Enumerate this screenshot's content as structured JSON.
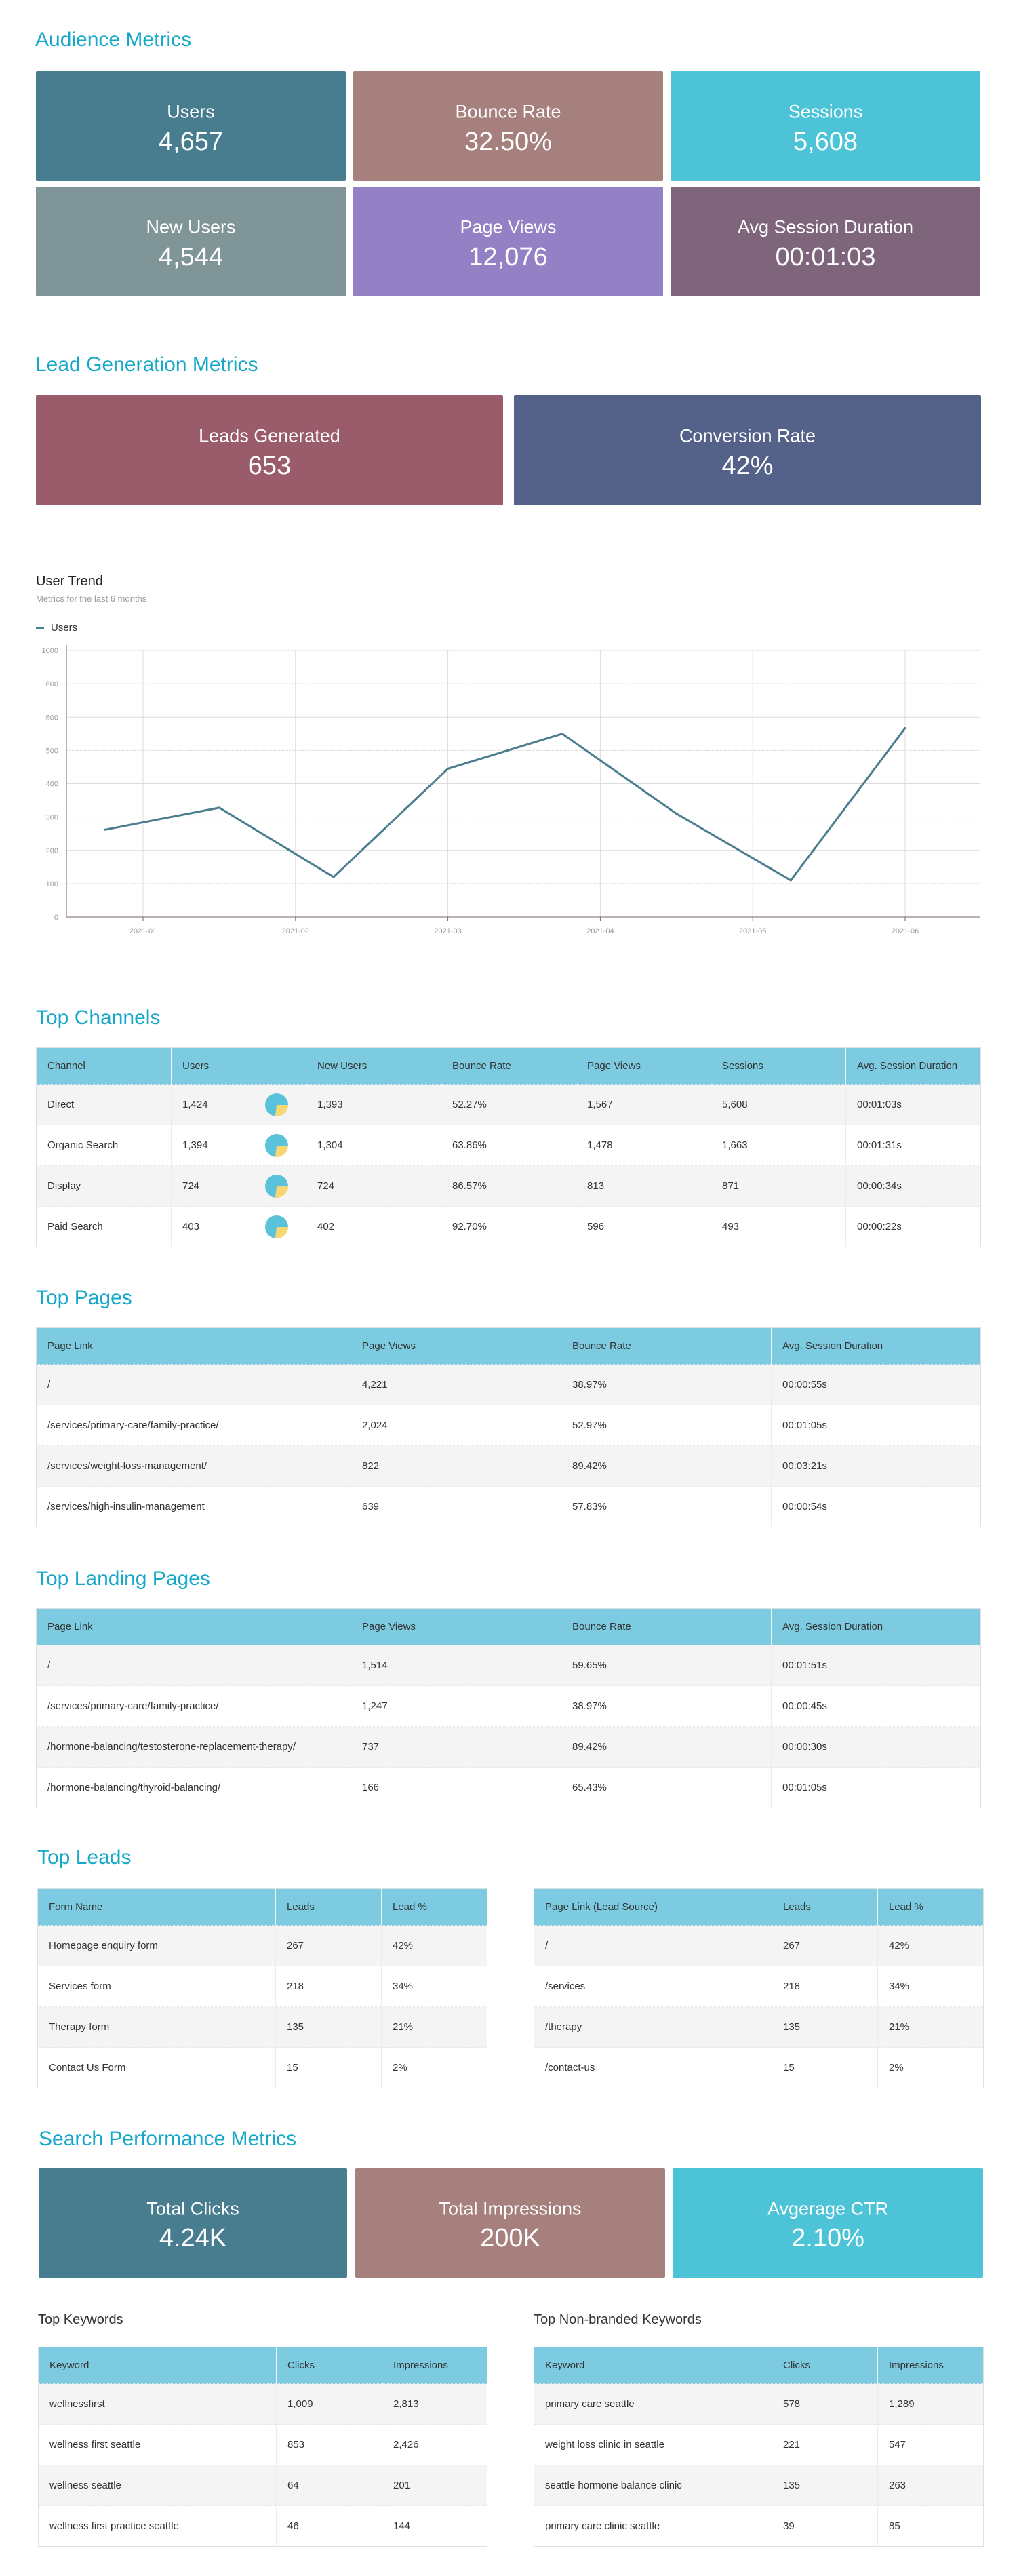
{
  "audience": {
    "title": "Audience Metrics",
    "cards": [
      {
        "label": "Users",
        "value": "4,657",
        "color": "#487d8f"
      },
      {
        "label": "Bounce Rate",
        "value": "32.50%",
        "color": "#a6807d"
      },
      {
        "label": "Sessions",
        "value": "5,608",
        "color": "#4cc3d6"
      },
      {
        "label": "New Users",
        "value": "4,544",
        "color": "#809598"
      },
      {
        "label": "Page Views",
        "value": "12,076",
        "color": "#9480c5"
      },
      {
        "label": "Avg Session Duration",
        "value": "00:01:03",
        "color": "#7e657c"
      }
    ]
  },
  "lead_generation": {
    "title": "Lead Generation Metrics",
    "cards": [
      {
        "label": "Leads Generated",
        "value": "653",
        "color": "#9a5c6a"
      },
      {
        "label": "Conversion Rate",
        "value": "42%",
        "color": "#546289"
      }
    ]
  },
  "chart_data": {
    "type": "line",
    "title": "User Trend",
    "subtitle": "Metrics for the last 6 months",
    "legend": [
      {
        "name": "Users",
        "color": "#4a7d8e"
      }
    ],
    "legend_position": "top-left",
    "xlabel": "",
    "ylabel": "",
    "x_ticks": [
      "2021-01",
      "2021-02",
      "2021-03",
      "2021-04",
      "2021-05",
      "2021-06"
    ],
    "y_ticks": [
      "0",
      "100",
      "200",
      "300",
      "400",
      "500",
      "600",
      "800",
      "1000"
    ],
    "grid": true,
    "series": [
      {
        "name": "Users",
        "x": [
          -0.25,
          0.5,
          1.25,
          2.0,
          2.75,
          3.5,
          4.25,
          5.0
        ],
        "x_labels_note": "points fall roughly halfway between monthly ticks",
        "values": [
          262,
          328,
          120,
          445,
          550,
          310,
          110,
          567
        ]
      }
    ]
  },
  "top_channels": {
    "title": "Top Channels",
    "columns": [
      "Channel",
      "Users",
      "New Users",
      "Bounce Rate",
      "Page Views",
      "Sessions",
      "Avg. Session Duration"
    ],
    "rows": [
      {
        "channel": "Direct",
        "users": "1,424",
        "new_users": "1,393",
        "bounce_rate": "52.27%",
        "page_views": "1,567",
        "sessions": "5,608",
        "avg_duration": "00:01:03s",
        "pie_share": 0.73
      },
      {
        "channel": "Organic Search",
        "users": "1,394",
        "new_users": "1,304",
        "bounce_rate": "63.86%",
        "page_views": "1,478",
        "sessions": "1,663",
        "avg_duration": "00:01:31s",
        "pie_share": 0.73
      },
      {
        "channel": "Display",
        "users": "724",
        "new_users": "724",
        "bounce_rate": "86.57%",
        "page_views": "813",
        "sessions": "871",
        "avg_duration": "00:00:34s",
        "pie_share": 0.73
      },
      {
        "channel": "Paid Search",
        "users": "403",
        "new_users": "402",
        "bounce_rate": "92.70%",
        "page_views": "596",
        "sessions": "493",
        "avg_duration": "00:00:22s",
        "pie_share": 0.73
      }
    ],
    "pie_colors": {
      "main": "#5bc2dc",
      "rest": "#f7d774"
    }
  },
  "top_pages": {
    "title": "Top Pages",
    "columns": [
      "Page Link",
      "Page Views",
      "Bounce Rate",
      "Avg. Session Duration"
    ],
    "rows": [
      [
        "/",
        "4,221",
        "38.97%",
        "00:00:55s"
      ],
      [
        "/services/primary-care/family-practice/",
        "2,024",
        "52.97%",
        "00:01:05s"
      ],
      [
        "/services/weight-loss-management/",
        "822",
        "89.42%",
        "00:03:21s"
      ],
      [
        "/services/high-insulin-management",
        "639",
        "57.83%",
        "00:00:54s"
      ]
    ]
  },
  "top_landing_pages": {
    "title": "Top Landing Pages",
    "columns": [
      "Page Link",
      "Page Views",
      "Bounce Rate",
      "Avg. Session Duration"
    ],
    "rows": [
      [
        "/",
        "1,514",
        "59.65%",
        "00:01:51s"
      ],
      [
        "/services/primary-care/family-practice/",
        "1,247",
        "38.97%",
        "00:00:45s"
      ],
      [
        "/hormone-balancing/testosterone-replacement-therapy/",
        "737",
        "89.42%",
        "00:00:30s"
      ],
      [
        "/hormone-balancing/thyroid-balancing/",
        "166",
        "65.43%",
        "00:01:05s"
      ]
    ]
  },
  "top_leads": {
    "title": "Top Leads",
    "forms_table": {
      "columns": [
        "Form Name",
        "Leads",
        "Lead %"
      ],
      "rows": [
        [
          "Homepage enquiry form",
          "267",
          "42%"
        ],
        [
          "Services form",
          "218",
          "34%"
        ],
        [
          "Therapy form",
          "135",
          "21%"
        ],
        [
          "Contact Us Form",
          "15",
          "2%"
        ]
      ]
    },
    "sources_table": {
      "columns": [
        "Page Link (Lead Source)",
        "Leads",
        "Lead %"
      ],
      "rows": [
        [
          "/",
          "267",
          "42%"
        ],
        [
          "/services",
          "218",
          "34%"
        ],
        [
          "/therapy",
          "135",
          "21%"
        ],
        [
          "/contact-us",
          "15",
          "2%"
        ]
      ]
    }
  },
  "search_performance": {
    "title": "Search Performance Metrics",
    "cards": [
      {
        "label": "Total Clicks",
        "value": "4.24K",
        "color": "#487d8f"
      },
      {
        "label": "Total Impressions",
        "value": "200K",
        "color": "#a6807d"
      },
      {
        "label": "Avgerage CTR",
        "value": "2.10%",
        "color": "#4cc3d6"
      }
    ],
    "top_keywords": {
      "title": "Top Keywords",
      "columns": [
        "Keyword",
        "Clicks",
        "Impressions"
      ],
      "rows": [
        [
          "wellnessfirst",
          "1,009",
          "2,813"
        ],
        [
          "wellness first seattle",
          "853",
          "2,426"
        ],
        [
          "wellness seattle",
          "64",
          "201"
        ],
        [
          "wellness first practice seattle",
          "46",
          "144"
        ]
      ]
    },
    "top_nonbranded_keywords": {
      "title": "Top Non-branded Keywords",
      "columns": [
        "Keyword",
        "Clicks",
        "Impressions"
      ],
      "rows": [
        [
          "primary care seattle",
          "578",
          "1,289"
        ],
        [
          "weight loss clinic in seattle",
          "221",
          "547"
        ],
        [
          "seattle hormone balance clinic",
          "135",
          "263"
        ],
        [
          "primary care clinic seattle",
          "39",
          "85"
        ]
      ]
    }
  }
}
